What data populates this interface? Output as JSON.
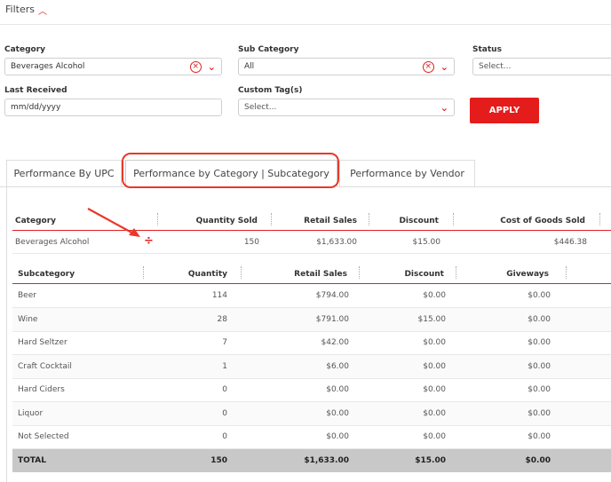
{
  "filters": {
    "toggle_label": "Filters",
    "category": {
      "label": "Category",
      "value": "Beverages Alcohol"
    },
    "sub_category": {
      "label": "Sub Category",
      "value": "All"
    },
    "status": {
      "label": "Status",
      "placeholder": "Select..."
    },
    "last_received": {
      "label": "Last Received",
      "placeholder": "mm/dd/yyyy"
    },
    "custom_tags": {
      "label": "Custom Tag(s)",
      "placeholder": "Select..."
    },
    "apply_label": "APPLY"
  },
  "tabs": [
    {
      "label": "Performance By UPC",
      "active": false
    },
    {
      "label": "Performance by Category | Subcategory",
      "active": true
    },
    {
      "label": "Performance by Vendor",
      "active": false
    }
  ],
  "category_table": {
    "headers": [
      "Category",
      "Quantity Sold",
      "Retail Sales",
      "Discount",
      "Cost of Goods Sold"
    ],
    "row": {
      "category": "Beverages Alcohol",
      "quantity": "150",
      "retail": "$1,633.00",
      "discount": "$15.00",
      "cogs": "$446.38"
    }
  },
  "subcategory_table": {
    "headers": [
      "Subcategory",
      "Quantity",
      "Retail Sales",
      "Discount",
      "Giveways"
    ],
    "rows": [
      {
        "name": "Beer",
        "qty": "114",
        "retail": "$794.00",
        "discount": "$0.00",
        "giveaways": "$0.00"
      },
      {
        "name": "Wine",
        "qty": "28",
        "retail": "$791.00",
        "discount": "$15.00",
        "giveaways": "$0.00"
      },
      {
        "name": "Hard Seltzer",
        "qty": "7",
        "retail": "$42.00",
        "discount": "$0.00",
        "giveaways": "$0.00"
      },
      {
        "name": "Craft Cocktail",
        "qty": "1",
        "retail": "$6.00",
        "discount": "$0.00",
        "giveaways": "$0.00"
      },
      {
        "name": "Hard Ciders",
        "qty": "0",
        "retail": "$0.00",
        "discount": "$0.00",
        "giveaways": "$0.00"
      },
      {
        "name": "Liquor",
        "qty": "0",
        "retail": "$0.00",
        "discount": "$0.00",
        "giveaways": "$0.00"
      },
      {
        "name": "Not Selected",
        "qty": "0",
        "retail": "$0.00",
        "discount": "$0.00",
        "giveaways": "$0.00"
      }
    ],
    "total": {
      "name": "TOTAL",
      "qty": "150",
      "retail": "$1,633.00",
      "discount": "$15.00",
      "giveaways": "$0.00"
    }
  },
  "colors": {
    "accent": "#e41c1c",
    "total_row": "#c8c8c8"
  }
}
